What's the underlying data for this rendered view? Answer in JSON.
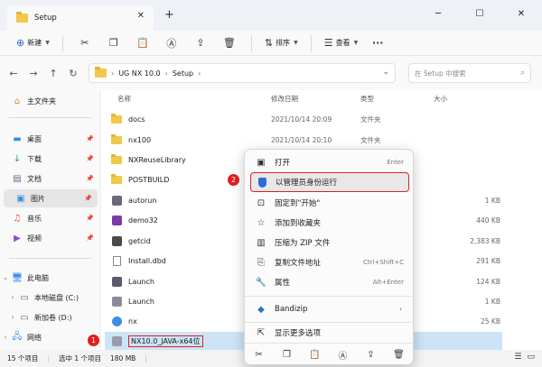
{
  "window": {
    "tab_title": "Setup",
    "tab_close": "✕",
    "new_tab": "+",
    "minimize": "─",
    "maximize": "☐",
    "close": "✕"
  },
  "toolbar": {
    "new_label": "新建",
    "sort_label": "排序",
    "view_label": "查看",
    "more": "···"
  },
  "address": {
    "crumbs": [
      "UG NX 10.0",
      "Setup"
    ],
    "search_placeholder": "在 Setup 中搜索"
  },
  "sidebar": {
    "home": "主文件夹",
    "quick": [
      "桌面",
      "下载",
      "文档",
      "图片",
      "音乐",
      "视频"
    ],
    "this_pc": "此电脑",
    "drives": [
      "本地磁盘 (C:)",
      "新加卷 (D:)"
    ],
    "network": "网络"
  },
  "columns": {
    "name": "名称",
    "date": "修改日期",
    "type": "类型",
    "size": "大小"
  },
  "files": [
    {
      "name": "docs",
      "date": "2021/10/14 20:09",
      "type": "文件夹",
      "size": "",
      "icon": "folder"
    },
    {
      "name": "nx100",
      "date": "2021/10/14 20:10",
      "type": "文件夹",
      "size": "",
      "icon": "folder"
    },
    {
      "name": "NXReuseLibrary",
      "date": "",
      "type": "",
      "size": "",
      "icon": "folder"
    },
    {
      "name": "POSTBUILD",
      "date": "",
      "type": "",
      "size": "",
      "icon": "folder"
    },
    {
      "name": "autorun",
      "date": "",
      "type": "",
      "size": "1 KB",
      "icon": "app"
    },
    {
      "name": "demo32",
      "date": "",
      "type": "",
      "size": "440 KB",
      "icon": "app"
    },
    {
      "name": "getcid",
      "date": "",
      "type": "",
      "size": "2,383 KB",
      "icon": "app"
    },
    {
      "name": "Install.dbd",
      "date": "",
      "type": "",
      "size": "291 KB",
      "icon": "doc"
    },
    {
      "name": "Launch",
      "date": "",
      "type": "",
      "size": "124 KB",
      "icon": "app"
    },
    {
      "name": "Launch",
      "date": "",
      "type": "",
      "size": "1 KB",
      "icon": "app"
    },
    {
      "name": "nx",
      "date": "",
      "type": "",
      "size": "25 KB",
      "icon": "app"
    },
    {
      "name": "NX10.0_JAVA-x64位",
      "date": "",
      "type": "",
      "size": "",
      "icon": "app"
    }
  ],
  "context_menu": {
    "items": [
      {
        "label": "打开",
        "shortcut": "Enter"
      },
      {
        "label": "以管理员身份运行",
        "shortcut": ""
      },
      {
        "label": "固定到\"开始\"",
        "shortcut": ""
      },
      {
        "label": "添加到收藏夹",
        "shortcut": ""
      },
      {
        "label": "压缩为 ZIP 文件",
        "shortcut": ""
      },
      {
        "label": "复制文件地址",
        "shortcut": "Ctrl+Shift+C"
      },
      {
        "label": "属性",
        "shortcut": "Alt+Enter"
      },
      {
        "label": "Bandizip",
        "shortcut": ""
      },
      {
        "label": "显示更多选项",
        "shortcut": ""
      }
    ]
  },
  "badges": {
    "one": "1",
    "two": "2"
  },
  "status": {
    "count": "15 个项目",
    "selected": "选中 1 个项目",
    "size": "180 MB"
  },
  "colors": {
    "accent": "#2e6fc2",
    "highlight_border": "#e02020",
    "selection": "#cce4f7"
  }
}
